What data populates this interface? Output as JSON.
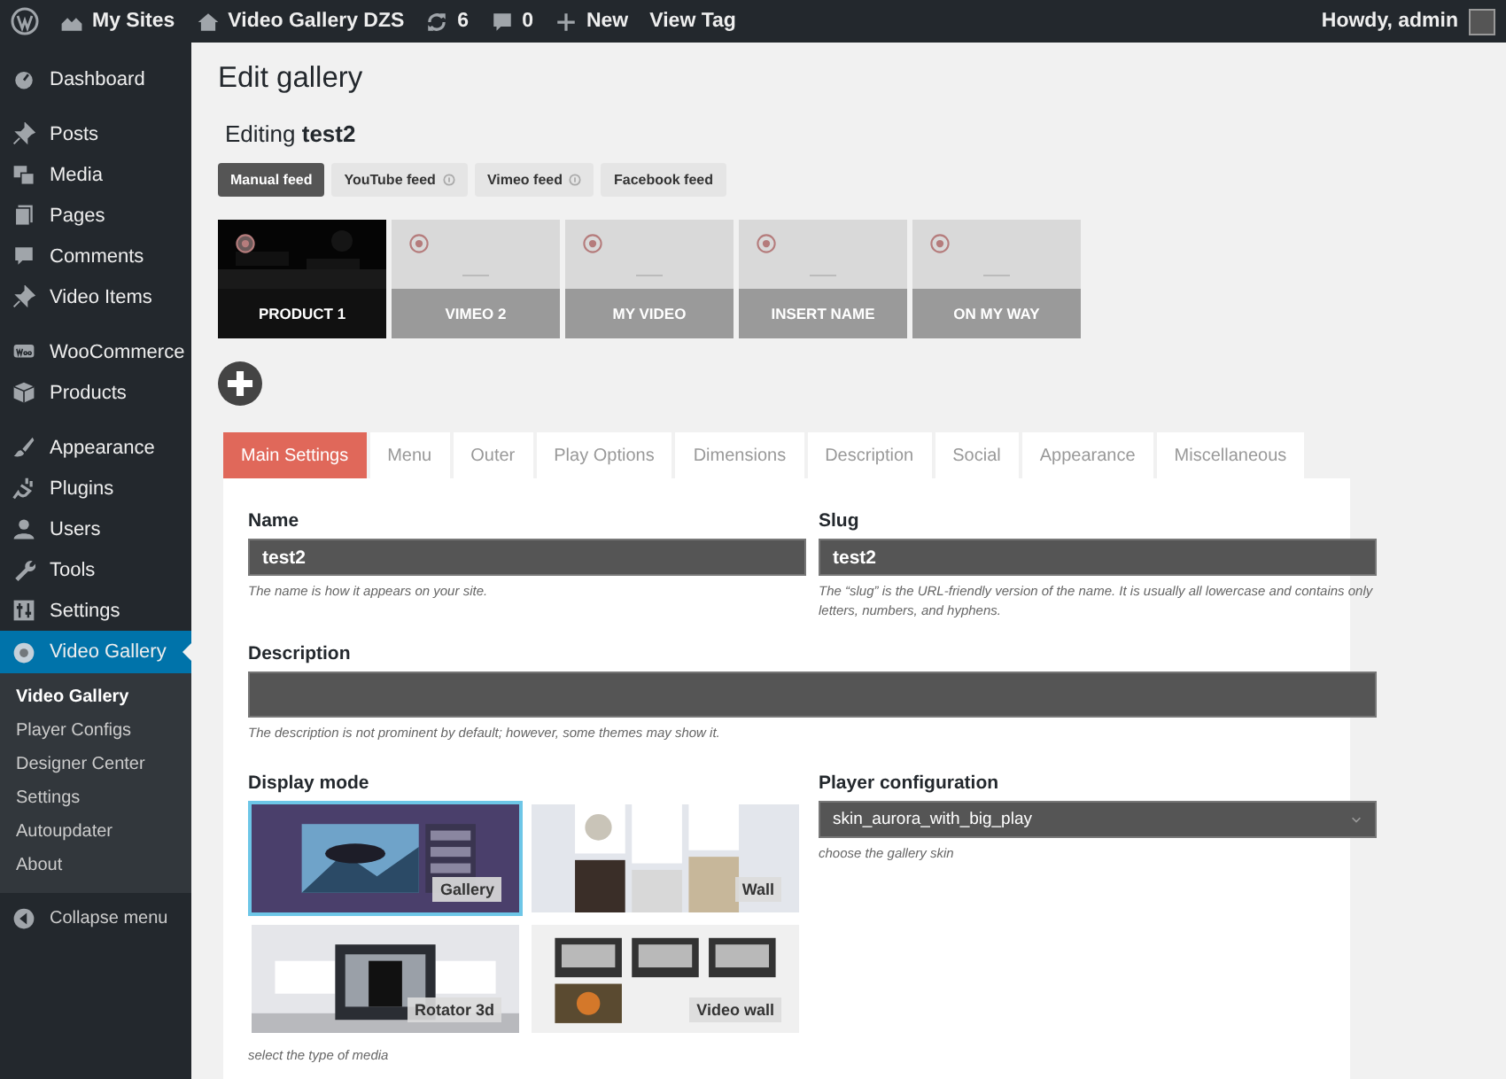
{
  "admin_bar": {
    "items": [
      {
        "kind": "wordpress"
      },
      {
        "kind": "sites",
        "label": "My Sites"
      },
      {
        "kind": "home",
        "label": "Video Gallery DZS"
      },
      {
        "kind": "updates",
        "label": "6"
      },
      {
        "kind": "comments",
        "label": "0"
      },
      {
        "kind": "new",
        "label": "New"
      },
      {
        "kind": "none",
        "label": "View Tag"
      }
    ],
    "account": "Howdy, admin"
  },
  "sidebar": {
    "groups": [
      [
        {
          "kind": "dashboard",
          "label": "Dashboard",
          "selected": false
        }
      ],
      [
        {
          "kind": "pin",
          "label": "Posts",
          "selected": false
        },
        {
          "kind": "media",
          "label": "Media",
          "selected": false
        },
        {
          "kind": "pages",
          "label": "Pages",
          "selected": false
        },
        {
          "kind": "comment",
          "label": "Comments",
          "selected": false
        },
        {
          "kind": "pin",
          "label": "Video Items",
          "selected": false
        }
      ],
      [
        {
          "kind": "woo",
          "label": "WooCommerce",
          "selected": false
        },
        {
          "kind": "box",
          "label": "Products",
          "selected": false
        }
      ],
      [
        {
          "kind": "brush",
          "label": "Appearance",
          "selected": false
        },
        {
          "kind": "plug",
          "label": "Plugins",
          "selected": false
        },
        {
          "kind": "user",
          "label": "Users",
          "selected": false
        },
        {
          "kind": "wrench",
          "label": "Tools",
          "selected": false
        },
        {
          "kind": "sliders",
          "label": "Settings",
          "selected": false
        },
        {
          "kind": "dot",
          "label": "Video Gallery",
          "selected": true
        }
      ]
    ],
    "submenu": [
      {
        "label": "Video Gallery",
        "selected": true
      },
      {
        "label": "Player Configs",
        "selected": false
      },
      {
        "label": "Designer Center",
        "selected": false
      },
      {
        "label": "Settings",
        "selected": false
      },
      {
        "label": "Autoupdater",
        "selected": false
      },
      {
        "label": "About",
        "selected": false
      }
    ],
    "collapse": "Collapse menu"
  },
  "page": {
    "title": "Edit gallery",
    "subtitle": "Editing **test2**",
    "feeds": [
      {
        "label": "Manual feed",
        "selected": true,
        "info": false
      },
      {
        "label": "YouTube feed",
        "selected": false,
        "info": true
      },
      {
        "label": "Vimeo feed",
        "selected": false,
        "info": true
      },
      {
        "label": "Facebook feed",
        "selected": false,
        "info": false
      }
    ],
    "items": [
      {
        "title": "PRODUCT 1",
        "has_image": true
      },
      {
        "title": "VIMEO 2",
        "has_image": false
      },
      {
        "title": "MY VIDEO",
        "has_image": false
      },
      {
        "title": "INSERT NAME",
        "has_image": false
      },
      {
        "title": "ON MY WAY",
        "has_image": false
      }
    ],
    "tabs": [
      {
        "label": "Main Settings",
        "selected": true
      },
      {
        "label": "Menu",
        "selected": false
      },
      {
        "label": "Outer",
        "selected": false
      },
      {
        "label": "Play Options",
        "selected": false
      },
      {
        "label": "Dimensions",
        "selected": false
      },
      {
        "label": "Description",
        "selected": false
      },
      {
        "label": "Social",
        "selected": false
      },
      {
        "label": "Appearance",
        "selected": false
      },
      {
        "label": "Miscellaneous",
        "selected": false
      }
    ],
    "name": {
      "label": "Name",
      "value": "test2",
      "hint": "The name is how it appears on your site."
    },
    "slug": {
      "label": "Slug",
      "value": "test2",
      "hint": "The “slug” is the URL-friendly version of the name. It is usually all lowercase and contains only letters, numbers, and hyphens."
    },
    "description": {
      "label": "Description",
      "hint": "The description is not prominent by default; however, some themes may show it."
    },
    "display_mode": {
      "label": "Display mode",
      "hint": "select the type of media",
      "options": [
        {
          "label": "Gallery",
          "selected": true
        },
        {
          "label": "Wall",
          "selected": false
        },
        {
          "label": "Rotator 3d",
          "selected": false
        },
        {
          "label": "Video wall",
          "selected": false
        }
      ]
    },
    "player_configuration": {
      "label": "Player configuration",
      "value": "skin_aurora_with_big_play",
      "hint": "choose the gallery skin"
    }
  }
}
